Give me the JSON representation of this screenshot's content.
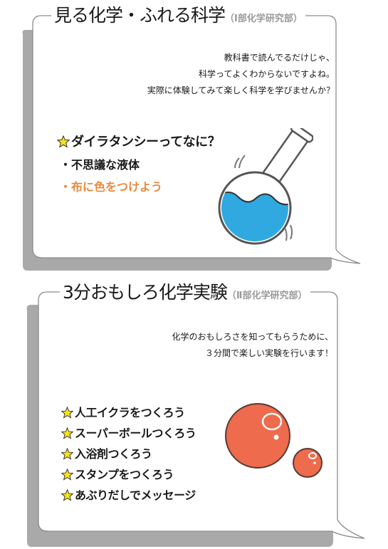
{
  "section1": {
    "title": "見る化学・ふれる科学",
    "subtitle": "（Ⅰ部化学研究部）",
    "intro": [
      "教科書で読んでるだけじゃ、",
      "科学ってよくわからないですよね。",
      "実際に体験してみて楽しく科学を学びませんか？"
    ],
    "topic": "ダイラタンシーってなに？",
    "bullets": [
      {
        "text": "・不思議な液体"
      },
      {
        "text": "・布に色をつけよう",
        "color": "#e88a3c"
      }
    ],
    "illustration": "round-flask-icon"
  },
  "section2": {
    "title": "3分おもしろ化学実験",
    "subtitle": "（Ⅱ部化学研究部）",
    "intro": [
      "化学のおもしろさを知ってもらうために、",
      "３分間で楽しい実験を行います！"
    ],
    "items": [
      "人工イクラをつくろう",
      "スーパーボールつくろう",
      "入浴剤つくろう",
      "スタンプをつくろう",
      "あぶりだしでメッセージ"
    ],
    "illustration": "orange-spheres-icon"
  },
  "colors": {
    "shadow": "#a9a9aa",
    "frame": "#8c8c8c",
    "star": "#f4e21c",
    "liquid": "#2fa9e0",
    "sphere": "#ee6b4d",
    "orange_text": "#e88a3c"
  }
}
